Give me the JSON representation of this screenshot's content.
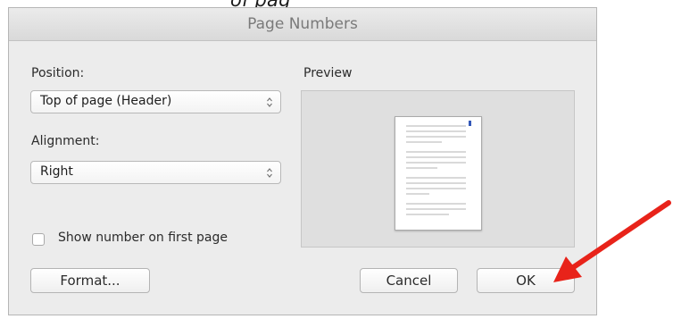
{
  "context": {
    "top_fragment_text": "of pag"
  },
  "dialog": {
    "title": "Page Numbers",
    "position": {
      "label": "Position:",
      "selected": "Top of page (Header)"
    },
    "alignment": {
      "label": "Alignment:",
      "selected": "Right"
    },
    "preview": {
      "label": "Preview"
    },
    "show_number_checkbox": {
      "label": "Show number on first page",
      "checked": false
    },
    "buttons": {
      "format": "Format...",
      "cancel": "Cancel",
      "ok": "OK"
    }
  },
  "annotation": {
    "arrow_color": "#e8231a",
    "arrow_target": "OK button"
  },
  "icons": {
    "select_stepper": "up-down-chevron-icon",
    "page_preview": "page-thumbnail-icon",
    "annotation_arrow": "red-arrow-icon"
  }
}
